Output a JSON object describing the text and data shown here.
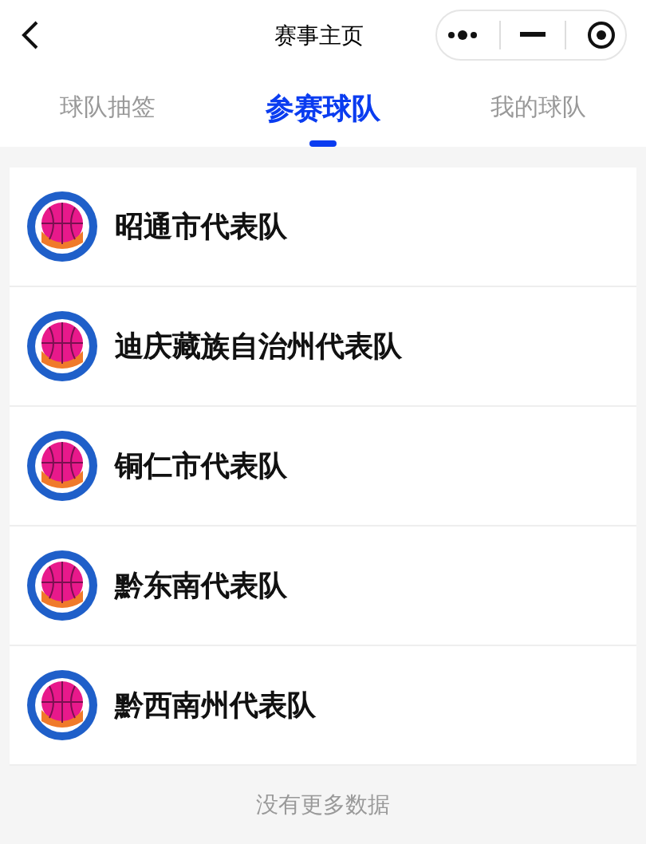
{
  "nav_bar": {
    "title": "赛事主页"
  },
  "tabs": [
    {
      "label": "球队抽签",
      "selected": false
    },
    {
      "label": "参赛球队",
      "selected": true
    },
    {
      "label": "我的球队",
      "selected": false
    }
  ],
  "teams": [
    {
      "name": "昭通市代表队"
    },
    {
      "name": "迪庆藏族自治州代表队"
    },
    {
      "name": "铜仁市代表队"
    },
    {
      "name": "黔东南代表队"
    },
    {
      "name": "黔西南州代表队"
    }
  ],
  "footer": "没有更多数据"
}
